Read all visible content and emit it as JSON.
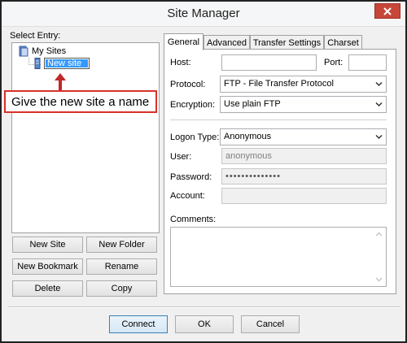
{
  "window": {
    "title": "Site Manager"
  },
  "left": {
    "select_entry_label": "Select Entry:",
    "tree": {
      "root": "My Sites",
      "new_site": "New site"
    },
    "callout_text": "Give the new site a name",
    "buttons": {
      "new_site": "New Site",
      "new_folder": "New Folder",
      "new_bookmark": "New Bookmark",
      "rename": "Rename",
      "delete": "Delete",
      "copy": "Copy"
    }
  },
  "tabs": [
    "General",
    "Advanced",
    "Transfer Settings",
    "Charset"
  ],
  "general": {
    "host_label": "Host:",
    "host_value": "",
    "port_label": "Port:",
    "port_value": "",
    "protocol_label": "Protocol:",
    "protocol_value": "FTP - File Transfer Protocol",
    "encryption_label": "Encryption:",
    "encryption_value": "Use plain FTP",
    "logon_type_label": "Logon Type:",
    "logon_type_value": "Anonymous",
    "user_label": "User:",
    "user_value": "anonymous",
    "password_label": "Password:",
    "password_value": "••••••••••••••",
    "account_label": "Account:",
    "account_value": "",
    "comments_label": "Comments:"
  },
  "footer": {
    "connect": "Connect",
    "ok": "OK",
    "cancel": "Cancel"
  },
  "colors": {
    "close_button": "#c7463a",
    "callout_border": "#d6322a",
    "arrow": "#c0282a",
    "selection": "#3399ff"
  }
}
